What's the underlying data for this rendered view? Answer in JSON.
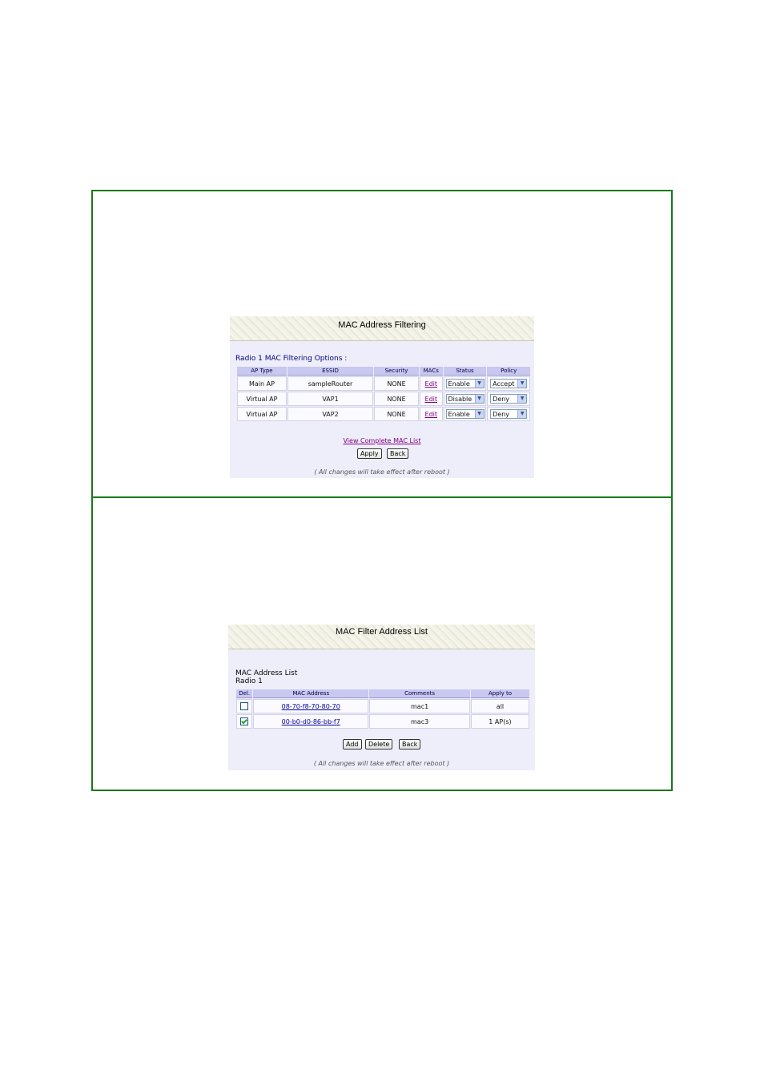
{
  "filtering": {
    "title": "MAC Address Filtering",
    "section_label": "Radio 1 MAC Filtering Options :",
    "columns": [
      "AP Type",
      "ESSID",
      "Security",
      "MACs",
      "Status",
      "Policy"
    ],
    "rows": [
      {
        "ap_type": "Main AP",
        "essid": "sampleRouter",
        "security": "NONE",
        "macs": "Edit",
        "status": "Enable",
        "policy": "Accept"
      },
      {
        "ap_type": "Virtual AP",
        "essid": "VAP1",
        "security": "NONE",
        "macs": "Edit",
        "status": "Disable",
        "policy": "Deny"
      },
      {
        "ap_type": "Virtual AP",
        "essid": "VAP2",
        "security": "NONE",
        "macs": "Edit",
        "status": "Enable",
        "policy": "Deny"
      }
    ],
    "view_list_link": "View Complete MAC List",
    "apply_label": "Apply",
    "back_label": "Back",
    "note": "( All changes will take effect after reboot )"
  },
  "address_list": {
    "title": "MAC Filter Address List",
    "list_label": "MAC Address List",
    "radio_label": "Radio 1",
    "columns": [
      "Del.",
      "MAC Address",
      "Comments",
      "Apply to"
    ],
    "rows": [
      {
        "checked": false,
        "mac": "08-70-f8-70-80-70",
        "comment": "mac1",
        "apply_to": "all"
      },
      {
        "checked": true,
        "mac": "00-b0-d0-86-bb-f7",
        "comment": "mac3",
        "apply_to": "1 AP(s)"
      }
    ],
    "add_label": "Add",
    "delete_label": "Delete",
    "back_label": "Back",
    "note": "( All changes will take effect after reboot )"
  }
}
